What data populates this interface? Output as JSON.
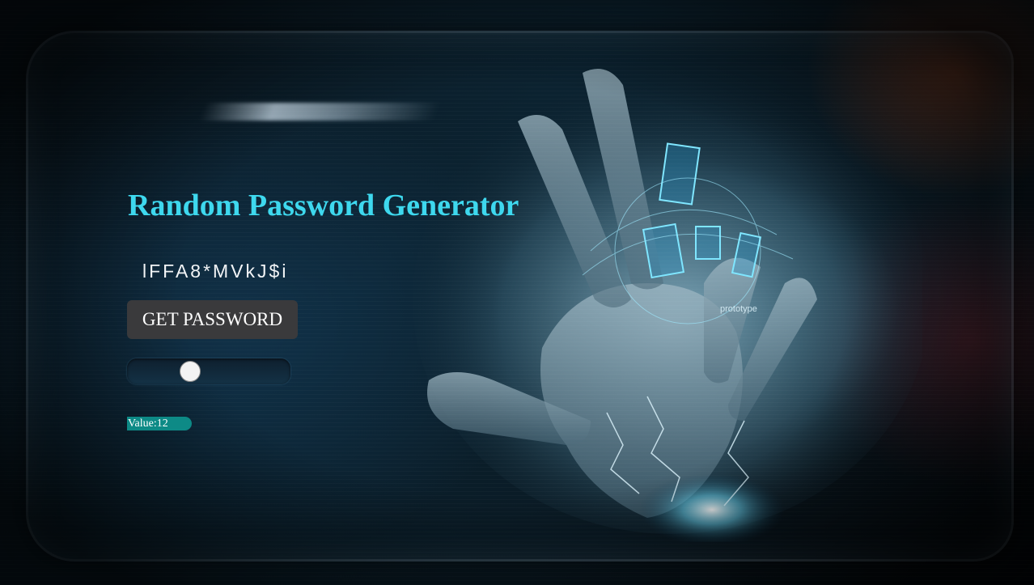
{
  "app": {
    "title": "Random Password Generator"
  },
  "password": {
    "value": "lFFA8*MVkJ$i"
  },
  "controls": {
    "get_button_label": "GET PASSWORD",
    "slider": {
      "value": 12,
      "min": 8,
      "max": 32
    },
    "value_label": "Value:12"
  },
  "colors": {
    "title": "#3ed8ee",
    "button_bg": "#3a3a3c",
    "badge_bg": "#0d8a86"
  },
  "background": {
    "icon": "cyber-hand-background",
    "logo_text": "prototype"
  }
}
